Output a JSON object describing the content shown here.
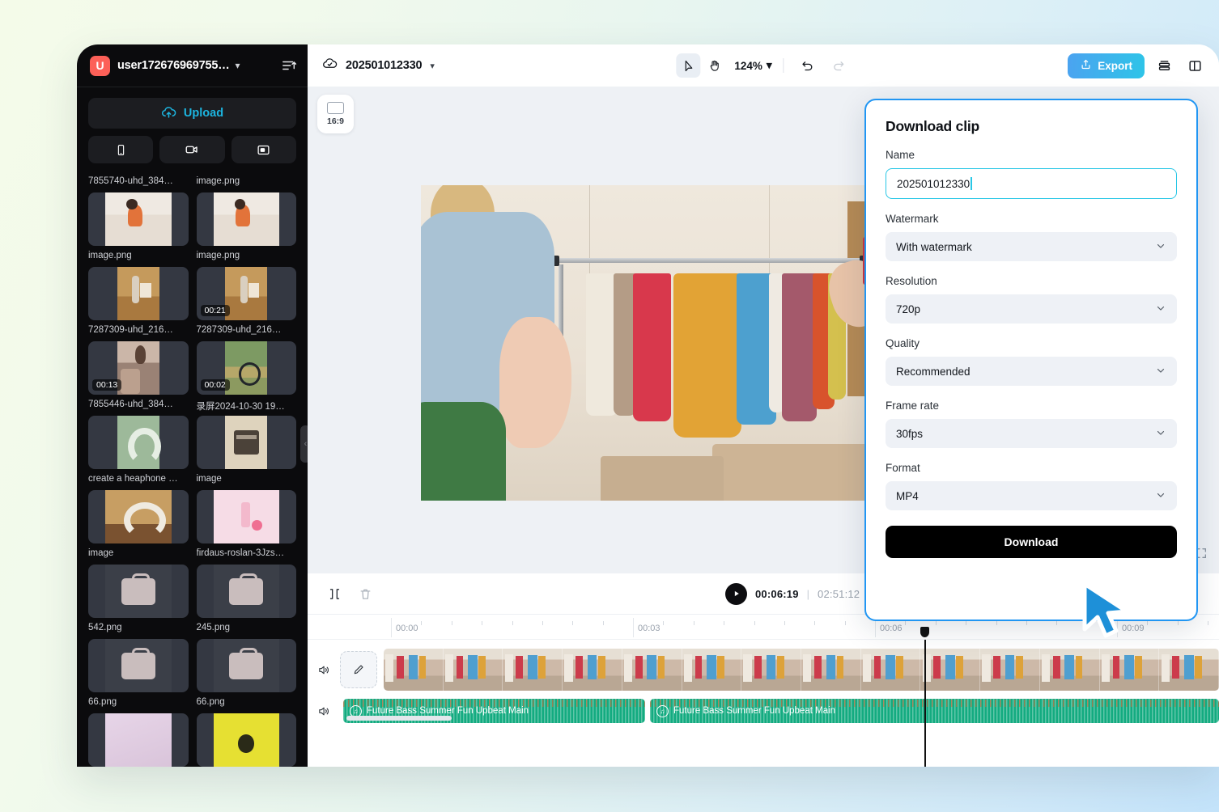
{
  "sidebar": {
    "avatar_initial": "U",
    "username": "user172676969755…",
    "caret_icon": "chevron-down-icon",
    "sort_icon": "sort-icon",
    "upload_label": "Upload",
    "upload_icon": "cloud-upload-icon",
    "source_buttons": [
      {
        "name": "phone-source-button",
        "icon": "phone-icon"
      },
      {
        "name": "camera-source-button",
        "icon": "video-camera-icon"
      },
      {
        "name": "screen-source-button",
        "icon": "screen-record-icon"
      }
    ],
    "collapse_icon": "chevron-left-icon",
    "media": [
      {
        "label": "7855740-uhd_384…",
        "duration": "",
        "art": "art-sofa"
      },
      {
        "label": "image.png",
        "duration": "",
        "art": "art-sofa"
      },
      {
        "label": "image.png",
        "duration": "",
        "art": "art-work"
      },
      {
        "label": "image.png",
        "duration": "00:21",
        "art": "art-work"
      },
      {
        "label": "7287309-uhd_216…",
        "duration": "00:13",
        "art": "art-box"
      },
      {
        "label": "7287309-uhd_216…",
        "duration": "00:02",
        "art": "art-bike"
      },
      {
        "label": "7855446-uhd_384…",
        "duration": "",
        "art": "art-head-green"
      },
      {
        "label": "录屏2024-10-30 19…",
        "duration": "",
        "art": "art-palette"
      },
      {
        "label": "create a heaphone …",
        "duration": "",
        "art": "art-head-wood"
      },
      {
        "label": "image",
        "duration": "",
        "art": "art-pink"
      },
      {
        "label": "image",
        "duration": "",
        "art": "art-bag"
      },
      {
        "label": "firdaus-roslan-3Jzs…",
        "duration": "",
        "art": "art-bag"
      },
      {
        "label": "542.png",
        "duration": "",
        "art": "art-bag"
      },
      {
        "label": "245.png",
        "duration": "",
        "art": "art-bag"
      },
      {
        "label": "66.png",
        "duration": "",
        "art": "art-lilac"
      },
      {
        "label": "66.png",
        "duration": "",
        "art": "art-yellow"
      }
    ]
  },
  "topbar": {
    "cloud_icon": "cloud-check-icon",
    "project_name": "202501012330",
    "project_caret_icon": "chevron-down-icon",
    "select_tool_icon": "cursor-arrow-icon",
    "hand_tool_icon": "hand-icon",
    "zoom_level": "124%",
    "zoom_caret_icon": "chevron-down-icon",
    "undo_icon": "undo-icon",
    "redo_icon": "redo-icon",
    "export_label": "Export",
    "export_icon": "share-upload-icon",
    "layers_icon": "layers-icon",
    "panel_toggle_icon": "split-panel-icon"
  },
  "canvas": {
    "ratio_label": "16:9",
    "ratio_icon": "rectangle-icon",
    "fullscreen_icon": "expand-icon"
  },
  "timeline": {
    "split_icon": "split-clip-icon",
    "delete_icon": "trash-icon",
    "play_icon": "play-icon",
    "current_time": "00:06:19",
    "time_separator": "|",
    "total_time": "02:51:12",
    "ruler_labels": [
      "00:00",
      "00:03",
      "00:06",
      "00:09"
    ],
    "video_track": {
      "mute_icon": "speaker-icon",
      "edit_icon": "pencil-icon"
    },
    "audio_track": {
      "mute_icon": "speaker-icon",
      "clips": [
        {
          "name": "Future Bass Summer Fun Upbeat Main",
          "icon": "music-note-icon"
        },
        {
          "name": "Future Bass Summer Fun Upbeat Main",
          "icon": "music-note-icon"
        }
      ]
    }
  },
  "download_panel": {
    "title": "Download clip",
    "name_label": "Name",
    "name_value": "202501012330",
    "watermark_label": "Watermark",
    "watermark_value": "With watermark",
    "resolution_label": "Resolution",
    "resolution_value": "720p",
    "quality_label": "Quality",
    "quality_value": "Recommended",
    "framerate_label": "Frame rate",
    "framerate_value": "30fps",
    "format_label": "Format",
    "format_value": "MP4",
    "download_label": "Download",
    "chevron_icon": "chevron-down-icon",
    "accent_color": "#2196f3",
    "input_focus_color": "#29c7e6"
  },
  "cursor": {
    "icon": "mouse-pointer-icon",
    "color": "#1e90d8"
  }
}
